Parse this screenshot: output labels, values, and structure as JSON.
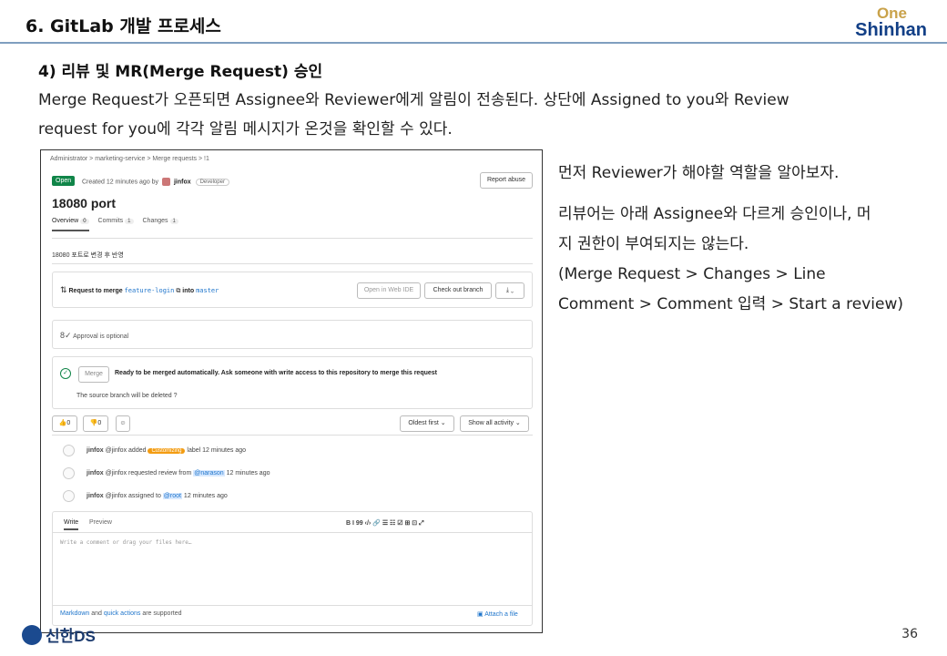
{
  "header": {
    "title": "6. GitLab 개발 프로세스",
    "logo_top": "One",
    "logo_bottom": "Shinhan"
  },
  "section": {
    "subtitle": "4) 리뷰 및 MR(Merge Request) 승인",
    "desc_line1": "Merge Request가 오픈되면 Assignee와 Reviewer에게 알림이 전송된다. 상단에 Assigned to you와 Review",
    "desc_line2": "request for you에 각각 알림 메시지가 온것을 확인할 수 있다."
  },
  "gitlab": {
    "breadcrumb": "Administrator  >  marketing-service  >  Merge requests  >  !1",
    "status": "Open",
    "created_prefix": "Created 12 minutes ago by",
    "author": "jinfox",
    "role": "Developer",
    "report_abuse": "Report abuse",
    "mr_title": "18080 port",
    "tabs": [
      {
        "label": "Overview",
        "count": "0"
      },
      {
        "label": "Commits",
        "count": "1"
      },
      {
        "label": "Changes",
        "count": "1"
      }
    ],
    "description": "18080 포트로 변경 후 반영",
    "request_to_merge": "Request to merge",
    "source_branch": "feature-login",
    "into": "into",
    "target_branch": "master",
    "open_web_ide": "Open in Web IDE",
    "checkout_branch": "Check out branch",
    "download": "⤓ ⌄",
    "approval": "Approval is optional",
    "merge_button": "Merge",
    "ready_text": "Ready to be merged automatically. Ask someone with write access to this repository to merge this request",
    "source_deleted": "The source branch will be deleted",
    "thumbs_up": "0",
    "thumbs_down": "0",
    "sort": "Oldest first ⌄",
    "filter": "Show all activity ⌄",
    "activities": [
      {
        "user": "jinfox",
        "handle": "@jinfox",
        "pre": "added",
        "badge": "Customizing",
        "post": "label 12 minutes ago"
      },
      {
        "user": "jinfox",
        "handle": "@jinfox",
        "pre": "requested review from",
        "badge": "@narason",
        "post": "12 minutes ago"
      },
      {
        "user": "jinfox",
        "handle": "@jinfox",
        "pre": "assigned to",
        "badge": "@root",
        "post": "12 minutes ago"
      }
    ],
    "write_tab": "Write",
    "preview_tab": "Preview",
    "toolbar": "B  I  99    ‹/›  🔗    ☰  ☷  ☑  ⊞  ⊡    ⤢",
    "comment_placeholder": "Write a comment or drag your files here…",
    "markdown_link": "Markdown",
    "and": "and",
    "quick_actions": "quick actions",
    "supported": "are supported",
    "attach": "Attach a file"
  },
  "notes": {
    "line1": "먼저 Reviewer가 해야할 역할을 알아보자.",
    "line2": "리뷰어는 아래 Assignee와 다르게 승인이나, 머",
    "line3": "지 권한이 부여되지는 않는다.",
    "line4": "(Merge Request > Changes > Line",
    "line5": "Comment > Comment 입력 > Start a review)"
  },
  "footer": {
    "company": "신한DS",
    "page": "36"
  }
}
